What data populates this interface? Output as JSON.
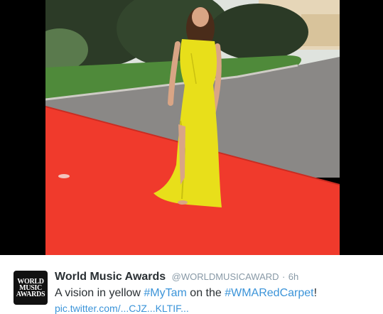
{
  "tweet": {
    "avatar_lines": [
      "WORLD",
      "MUSIC",
      "AWARDS"
    ],
    "display_name": "World Music Awards",
    "handle": "@WORLDMUSICAWARD",
    "separator": "·",
    "time": "6h",
    "text_before": "A vision in yellow ",
    "hashtag_1": "#MyTam",
    "text_middle": " on the ",
    "hashtag_2": "#WMARedCarpet",
    "text_end": "!",
    "link_partial": "pic.twitter.com/...CJZ...KLTIF..."
  },
  "colors": {
    "link": "#3b94d9",
    "red_carpet": "#f03a2c",
    "dress": "#e8df1a",
    "asphalt": "#8a8886",
    "grass": "#4f8a3a"
  }
}
